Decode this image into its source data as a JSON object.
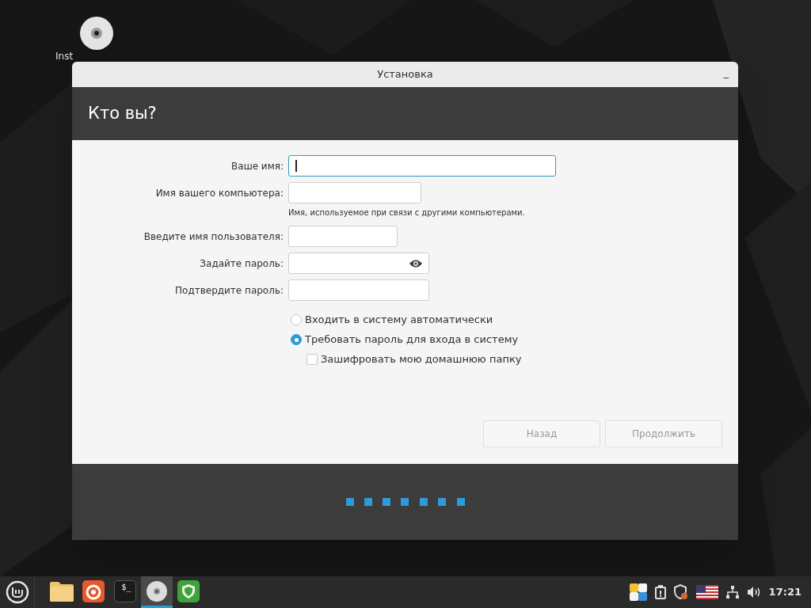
{
  "desktop": {
    "icons": [
      {
        "label": "Inst"
      }
    ]
  },
  "window": {
    "title": "Установка",
    "minimize": "_"
  },
  "header": {
    "title": "Кто вы?"
  },
  "form": {
    "fields": [
      {
        "label": "Ваше имя:",
        "kind": "text",
        "focused": true
      },
      {
        "label": "Имя вашего компьютера:",
        "kind": "text",
        "focused": false,
        "hint": "Имя, используемое при связи с другими компьютерами."
      },
      {
        "label": "Введите имя пользователя:",
        "kind": "text",
        "focused": false
      },
      {
        "label": "Задайте пароль:",
        "kind": "password",
        "focused": false
      },
      {
        "label": "Подтвердите пароль:",
        "kind": "text",
        "focused": false
      }
    ],
    "options": [
      {
        "kind": "radio",
        "label": "Входить в систему автоматически",
        "selected": false
      },
      {
        "kind": "radio",
        "label": "Требовать пароль для входа в систему",
        "selected": true
      },
      {
        "kind": "checkbox",
        "label": "Зашифровать мою домашнюю папку",
        "checked": false
      }
    ]
  },
  "buttons": [
    {
      "label": "Назад",
      "disabled": true
    },
    {
      "label": "Продолжить",
      "disabled": true
    }
  ],
  "taskbar": {
    "apps": [
      {
        "kind": "files",
        "active": false
      },
      {
        "kind": "firefox",
        "active": false
      },
      {
        "kind": "terminal",
        "glyph": "$_",
        "active": false
      },
      {
        "kind": "disc",
        "active": true
      },
      {
        "kind": "shield",
        "active": false
      }
    ],
    "clock": "17:21"
  }
}
